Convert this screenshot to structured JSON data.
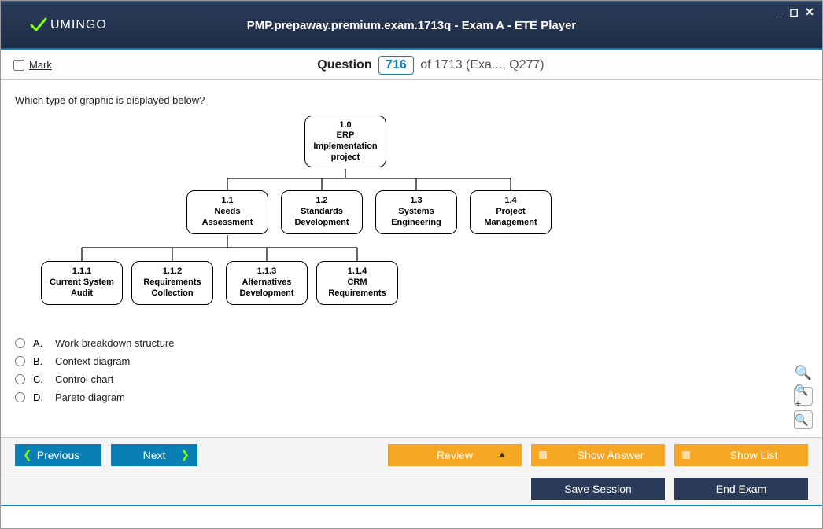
{
  "window": {
    "title": "PMP.prepaway.premium.exam.1713q - Exam A - ETE Player",
    "brand": "UMINGO"
  },
  "header": {
    "mark_label": "Mark",
    "question_word": "Question",
    "number": "716",
    "of_text": "of 1713 (Exa..., Q277)"
  },
  "question": {
    "prompt": "Which type of graphic is displayed below?",
    "answers": [
      {
        "letter": "A.",
        "text": "Work breakdown structure"
      },
      {
        "letter": "B.",
        "text": "Context diagram"
      },
      {
        "letter": "C.",
        "text": "Control chart"
      },
      {
        "letter": "D.",
        "text": "Pareto diagram"
      }
    ],
    "nodes": {
      "root": {
        "num": "1.0",
        "lbl": "ERP\nImplementation\nproject"
      },
      "n11": {
        "num": "1.1",
        "lbl": "Needs\nAssessment"
      },
      "n12": {
        "num": "1.2",
        "lbl": "Standards\nDevelopment"
      },
      "n13": {
        "num": "1.3",
        "lbl": "Systems\nEngineering"
      },
      "n14": {
        "num": "1.4",
        "lbl": "Project\nManagement"
      },
      "n111": {
        "num": "1.1.1",
        "lbl": "Current System\nAudit"
      },
      "n112": {
        "num": "1.1.2",
        "lbl": "Requirements\nCollection"
      },
      "n113": {
        "num": "1.1.3",
        "lbl": "Alternatives\nDevelopment"
      },
      "n114": {
        "num": "1.1.4",
        "lbl": "CRM\nRequirements"
      }
    }
  },
  "footer": {
    "previous": "Previous",
    "next": "Next",
    "review": "Review",
    "show_answer": "Show Answer",
    "show_list": "Show List",
    "save_session": "Save Session",
    "end_exam": "End Exam"
  }
}
